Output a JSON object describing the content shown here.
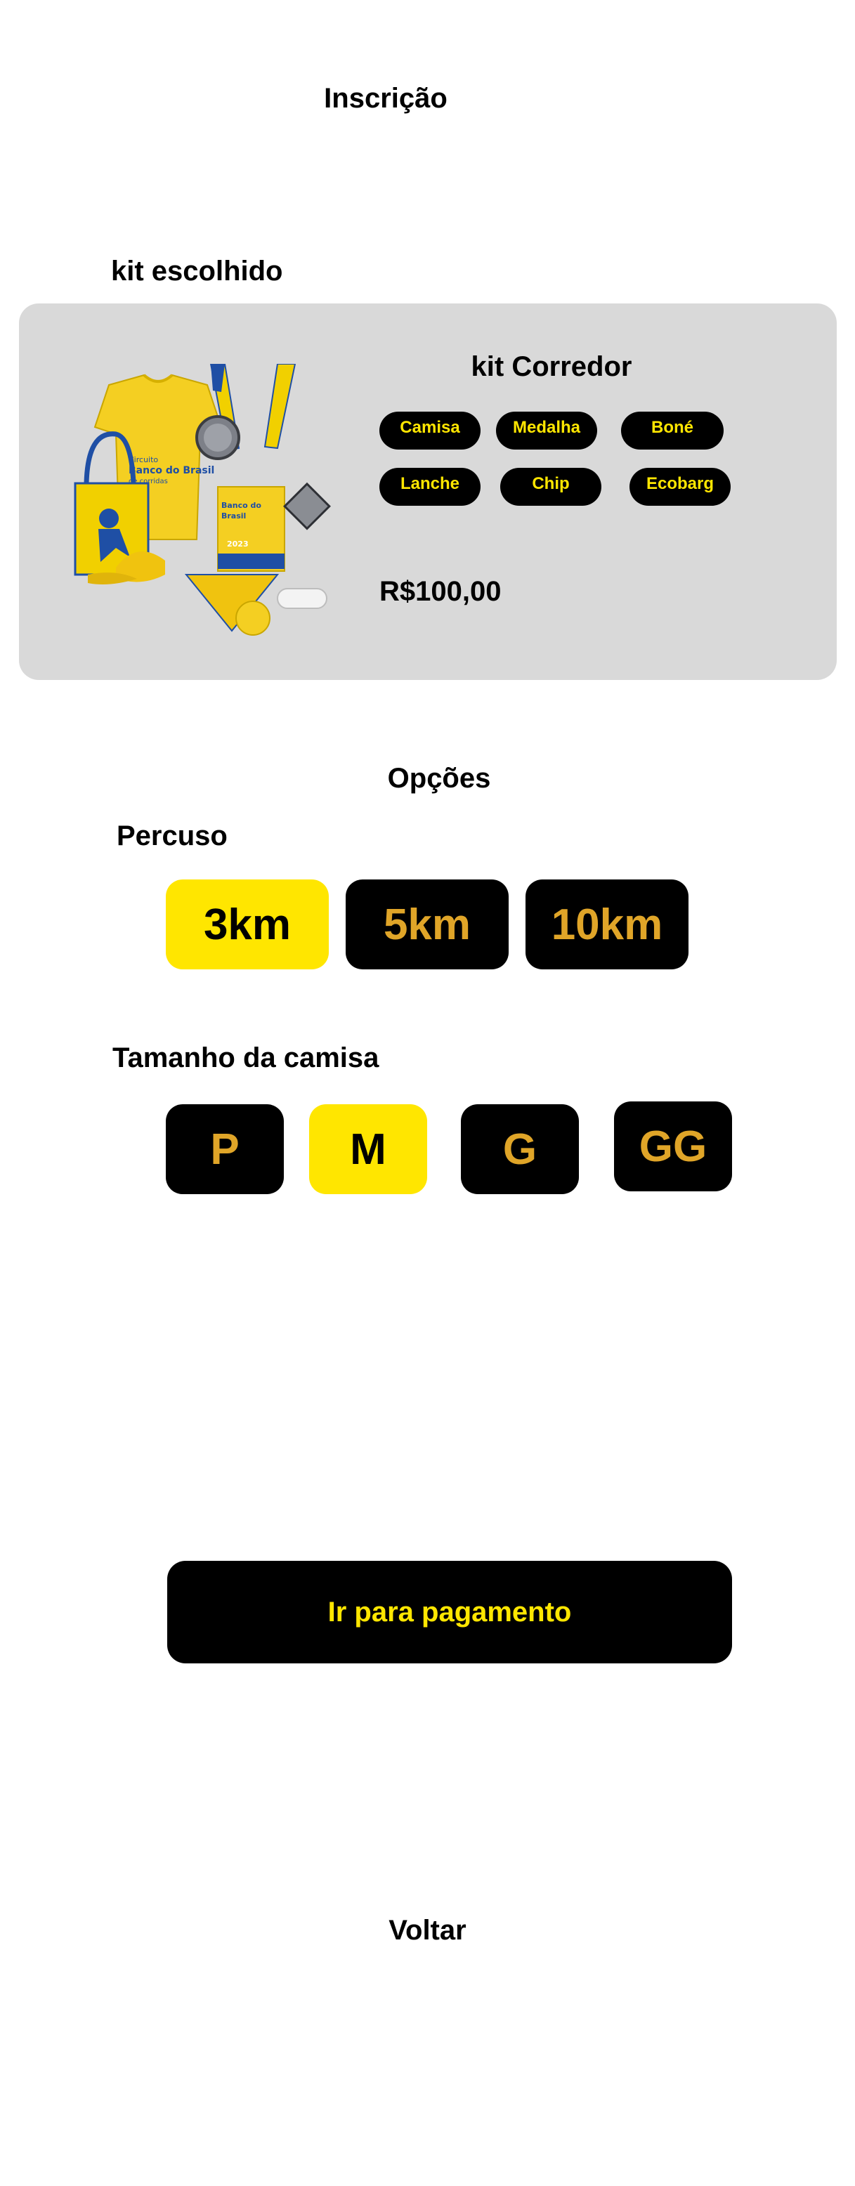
{
  "header": {
    "title": "Inscrição"
  },
  "kit_section": {
    "heading": "kit escolhido",
    "kit_name": "kit Corredor",
    "items": [
      "Camisa",
      "Medalha",
      "Boné",
      "Lanche",
      "Chip",
      "Ecobarg"
    ],
    "price": "R$100,00",
    "image_text": {
      "brand_line1": "Circuito",
      "brand_line2": "Banco do Brasil",
      "brand_line3": "de corridas",
      "year": "2023"
    }
  },
  "options": {
    "heading": "Opções",
    "route_heading": "Percuso",
    "routes": [
      "3km",
      "5km",
      "10km"
    ],
    "selected_route": "3km",
    "size_heading": "Tamanho da camisa",
    "sizes": [
      "P",
      "M",
      "G",
      "GG"
    ],
    "selected_size": "M"
  },
  "actions": {
    "pay_label": "Ir para pagamento",
    "back_label": "Voltar"
  },
  "colors": {
    "accent_yellow": "#ffe600",
    "option_text_gold": "#e0a528",
    "card_gray": "#d9d9d9",
    "brand_blue": "#1f4fa5"
  }
}
